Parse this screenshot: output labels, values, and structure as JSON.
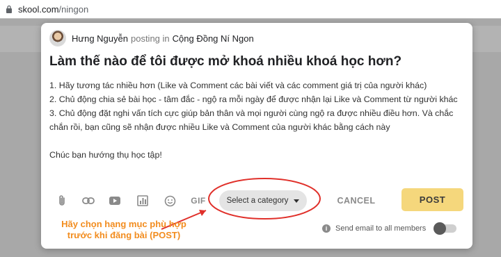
{
  "browser": {
    "url_host": "skool.com",
    "url_path": "/ningon"
  },
  "post": {
    "author": "Hưng Nguyễn",
    "posting_in": "posting in",
    "group": "Cộng Đồng Ní Ngon",
    "title": "Làm thế nào để tôi được mở khoá nhiều khoá học hơn?",
    "lines": [
      "1. Hãy tương tác nhiều hơn (Like và Comment các bài viết và các comment giá trị của người khác)",
      "2. Chủ động chia sẻ bài học - tâm đắc - ngộ ra mỗi ngày để được nhận lại Like và Comment từ người khác",
      "3. Chủ động đặt nghi vấn tích cực giúp bản thân và mọi người cùng ngộ ra được nhiều điều hơn. Và chắc chắn rồi, bạn cũng sẽ nhận được nhiều Like và Comment của người khác bằng cách này"
    ],
    "closing": "Chúc bạn hướng thụ học tập!"
  },
  "toolbar": {
    "icons": [
      "attachment-icon",
      "link-icon",
      "youtube-icon",
      "poll-icon",
      "emoji-icon"
    ],
    "gif_label": "GIF",
    "category_label": "Select a category",
    "cancel_label": "CANCEL",
    "post_label": "POST"
  },
  "email": {
    "label": "Send email to all members",
    "enabled": false
  },
  "annotation": {
    "text": "Hãy chọn hạng mục phù hợp trước khi đăng bài (POST)",
    "color": "#f28c1e",
    "circle_color": "#e0302a"
  },
  "colors": {
    "post_button": "#f5d77c",
    "category_pill": "#e4e4e4"
  }
}
